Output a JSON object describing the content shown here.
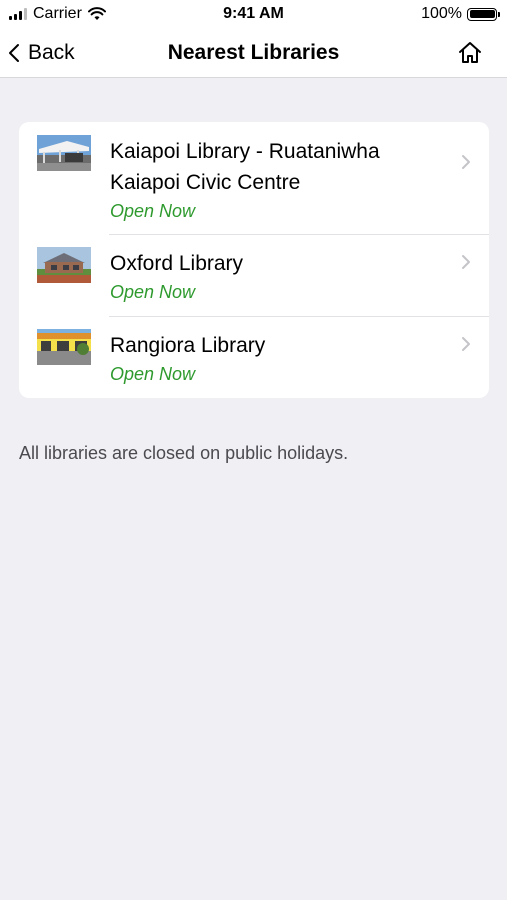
{
  "status_bar": {
    "carrier": "Carrier",
    "time": "9:41 AM",
    "battery": "100%"
  },
  "nav": {
    "back_label": "Back",
    "title": "Nearest Libraries",
    "home_icon": "home-icon"
  },
  "libraries": [
    {
      "name": "Kaiapoi Library - Ruataniwha Kaiapoi Civic Centre",
      "status": "Open Now"
    },
    {
      "name": "Oxford Library",
      "status": "Open Now"
    },
    {
      "name": "Rangiora Library",
      "status": "Open Now"
    }
  ],
  "note": "All libraries are closed on public holidays.",
  "colors": {
    "open_status": "#2e9a2e",
    "background": "#efeff4"
  }
}
